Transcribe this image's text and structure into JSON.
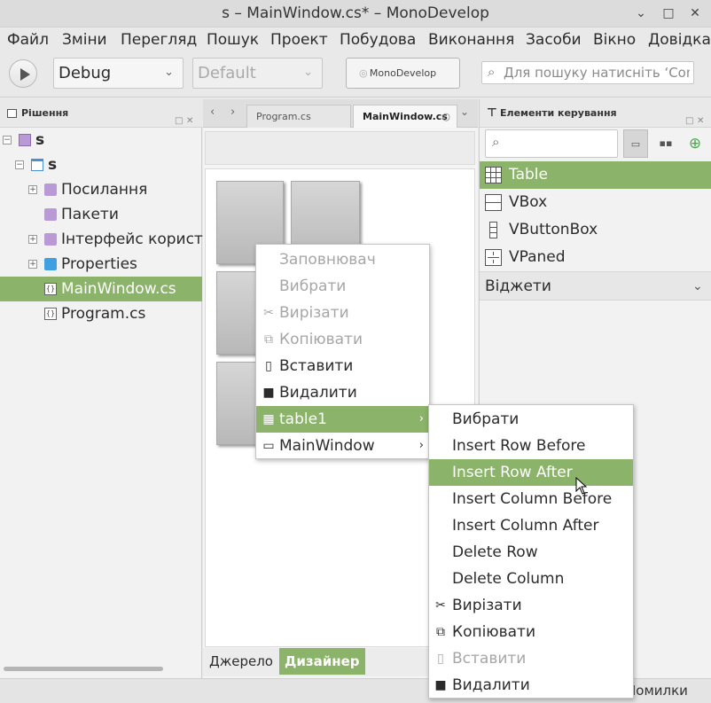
{
  "window": {
    "title": "s – MainWindow.cs* – MonoDevelop",
    "minimize_glyph": "⌄",
    "maximize_glyph": "□",
    "close_glyph": "✕"
  },
  "menubar": {
    "items": [
      "Файл",
      "Зміни",
      "Перегляд",
      "Пошук",
      "Проект",
      "Побудова",
      "Виконання",
      "Засоби",
      "Вікно",
      "Довідка"
    ]
  },
  "toolbar": {
    "configuration": "Debug",
    "runtime": "Default",
    "status_text": "MonoDevelop",
    "search_placeholder": "Для пошуку натисніть ‘Control+,’"
  },
  "solution_pad": {
    "title": "Рішення",
    "items": [
      {
        "label": "s",
        "bold": true,
        "icon": "solution-icon",
        "expander": "−"
      },
      {
        "label": "s",
        "bold": true,
        "icon": "project-icon",
        "expander": "−"
      },
      {
        "label": "Посилання",
        "icon": "references-folder-icon",
        "expander": "+"
      },
      {
        "label": "Пакети",
        "icon": "packages-folder-icon",
        "expander": ""
      },
      {
        "label": "Інтерфейс користувача",
        "icon": "ui-folder-icon",
        "expander": "+"
      },
      {
        "label": "Properties",
        "icon": "folder-icon",
        "expander": "+"
      },
      {
        "label": "MainWindow.cs",
        "icon": "csharp-file-icon",
        "expander": "",
        "selected": true
      },
      {
        "label": "Program.cs",
        "icon": "csharp-file-icon",
        "expander": ""
      }
    ]
  },
  "editor": {
    "tabs": [
      {
        "label": "Program.cs",
        "active": false
      },
      {
        "label": "MainWindow.cs",
        "active": true
      }
    ],
    "bottom_tabs": [
      {
        "label": "Джерело",
        "active": false
      },
      {
        "label": "Дизайнер",
        "active": true
      }
    ]
  },
  "toolbox_pad": {
    "title": "Елементи керування",
    "items": [
      {
        "label": "Table",
        "icon": "table-icon",
        "selected": true
      },
      {
        "label": "VBox",
        "icon": "vbox-icon",
        "selected": false
      },
      {
        "label": "VButtonBox",
        "icon": "vbuttonbox-icon",
        "selected": false
      },
      {
        "label": "VPaned",
        "icon": "vpaned-icon",
        "selected": false
      }
    ],
    "category": "Віджети"
  },
  "context_menu": {
    "items": [
      {
        "label": "Заповнювач",
        "enabled": false,
        "icon": ""
      },
      {
        "label": "Вибрати",
        "enabled": false,
        "icon": ""
      },
      {
        "label": "Вирізати",
        "enabled": false,
        "icon": "cut-icon"
      },
      {
        "label": "Копіювати",
        "enabled": false,
        "icon": "copy-icon"
      },
      {
        "label": "Вставити",
        "enabled": true,
        "icon": "paste-icon"
      },
      {
        "label": "Видалити",
        "enabled": true,
        "icon": "delete-icon"
      },
      {
        "label": "table1",
        "enabled": true,
        "icon": "table-icon",
        "submenu": true,
        "highlighted": true
      },
      {
        "label": "MainWindow",
        "enabled": true,
        "icon": "window-icon",
        "submenu": true
      }
    ]
  },
  "submenu": {
    "items": [
      {
        "label": "Вибрати",
        "enabled": true,
        "icon": ""
      },
      {
        "label": "Insert Row Before",
        "enabled": true,
        "icon": ""
      },
      {
        "label": "Insert Row After",
        "enabled": true,
        "icon": "",
        "highlighted": true
      },
      {
        "label": "Insert Column Before",
        "enabled": true,
        "icon": ""
      },
      {
        "label": "Insert Column After",
        "enabled": true,
        "icon": ""
      },
      {
        "label": "Delete Row",
        "enabled": true,
        "icon": ""
      },
      {
        "label": "Delete Column",
        "enabled": true,
        "icon": ""
      },
      {
        "label": "Вирізати",
        "enabled": true,
        "icon": "cut-icon"
      },
      {
        "label": "Копіювати",
        "enabled": true,
        "icon": "copy-icon"
      },
      {
        "label": "Вставити",
        "enabled": false,
        "icon": "paste-icon"
      },
      {
        "label": "Видалити",
        "enabled": true,
        "icon": "delete-icon"
      }
    ]
  },
  "statusbar": {
    "errors_label": "Помилки"
  },
  "colors": {
    "accent": "#8bb36a",
    "disabled_text": "#a6a6a6"
  }
}
